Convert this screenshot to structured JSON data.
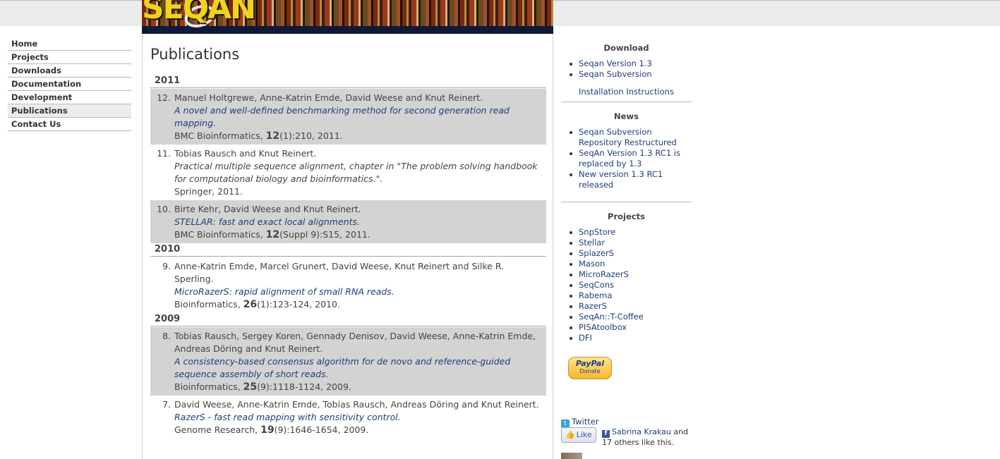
{
  "banner": {
    "logo_text": "SEQAN"
  },
  "nav": {
    "items": [
      {
        "label": "Home",
        "active": false
      },
      {
        "label": "Projects",
        "active": false
      },
      {
        "label": "Downloads",
        "active": false
      },
      {
        "label": "Documentation",
        "active": false
      },
      {
        "label": "Development",
        "active": false
      },
      {
        "label": "Publications",
        "active": true
      },
      {
        "label": "Contact Us",
        "active": false
      }
    ]
  },
  "main": {
    "title": "Publications",
    "years": [
      {
        "year": "2011",
        "pubs": [
          {
            "num": "12.",
            "authors": "Manuel Holtgrewe, Anne-Katrin Emde, David Weese and Knut Reinert.",
            "title": "A novel and well-defined benchmarking method for second generation read mapping.",
            "venue_pre": "BMC Bioinformatics, ",
            "volume": "12",
            "venue_post": "(1):210, 2011.",
            "shaded": true
          },
          {
            "num": "11.",
            "authors": "Tobias Rausch and Knut Reinert.",
            "title": "Practical multiple sequence alignment, chapter in \"The problem solving handbook for computational biology and bioinformatics.\".",
            "venue_pre": "Springer, 2011.",
            "volume": "",
            "venue_post": "",
            "shaded": false,
            "plain_title": true
          },
          {
            "num": "10.",
            "authors": "Birte Kehr, David Weese and Knut Reinert.",
            "title": "STELLAR: fast and exact local alignments.",
            "venue_pre": "BMC Bioinformatics, ",
            "volume": "12",
            "venue_post": "(Suppl 9):S15, 2011.",
            "shaded": true
          }
        ]
      },
      {
        "year": "2010",
        "pubs": [
          {
            "num": "9.",
            "authors": "Anne-Katrin Emde, Marcel Grunert, David Weese, Knut Reinert and Silke R. Sperling.",
            "title": "MicroRazerS: rapid alignment of small RNA reads.",
            "venue_pre": "Bioinformatics, ",
            "volume": "26",
            "venue_post": "(1):123-124, 2010.",
            "shaded": false
          }
        ]
      },
      {
        "year": "2009",
        "pubs": [
          {
            "num": "8.",
            "authors": "Tobias Rausch, Sergey Koren, Gennady Denisov, David Weese, Anne-Katrin Emde, Andreas Döring and Knut Reinert.",
            "title": "A consistency-based consensus algorithm for de novo and reference-guided sequence assembly of short reads.",
            "venue_pre": "Bioinformatics, ",
            "volume": "25",
            "venue_post": "(9):1118-1124, 2009.",
            "shaded": true
          },
          {
            "num": "7.",
            "authors": "David Weese, Anne-Katrin Emde, Tobias Rausch, Andreas Döring and Knut Reinert.",
            "title": "RazerS - fast read mapping with sensitivity control.",
            "venue_pre": "Genome Research, ",
            "volume": "19",
            "venue_post": "(9):1646-1654, 2009.",
            "shaded": false
          }
        ]
      }
    ]
  },
  "sidebar": {
    "download": {
      "heading": "Download",
      "links": [
        "Seqan Version 1.3",
        "Seqan Subversion"
      ],
      "install": "Installation Instructions"
    },
    "news": {
      "heading": "News",
      "links": [
        "Seqan Subversion Repository Restructured",
        "SeqAn Version 1.3 RC1 is replaced by 1.3",
        "New version 1.3 RC1 released"
      ]
    },
    "projects": {
      "heading": "Projects",
      "links": [
        "SnpStore",
        "Stellar",
        "SplazerS",
        "Mason",
        "MicroRazerS",
        "SeqCons",
        "Rabema",
        "RazerS",
        "SeqAn::T-Coffee",
        "PISAtoolbox",
        "DFI"
      ]
    },
    "paypal": {
      "logo": "PayPal",
      "donate": "Donate"
    },
    "twitter": {
      "label": "Twitter"
    },
    "facebook": {
      "like": "Like",
      "name": "Sabrina Krakau",
      "rest": " and 17 others like this."
    }
  },
  "colors": {
    "link": "#1f3e7a",
    "shade": "#d3d3d3",
    "active_nav": "#ececec"
  }
}
